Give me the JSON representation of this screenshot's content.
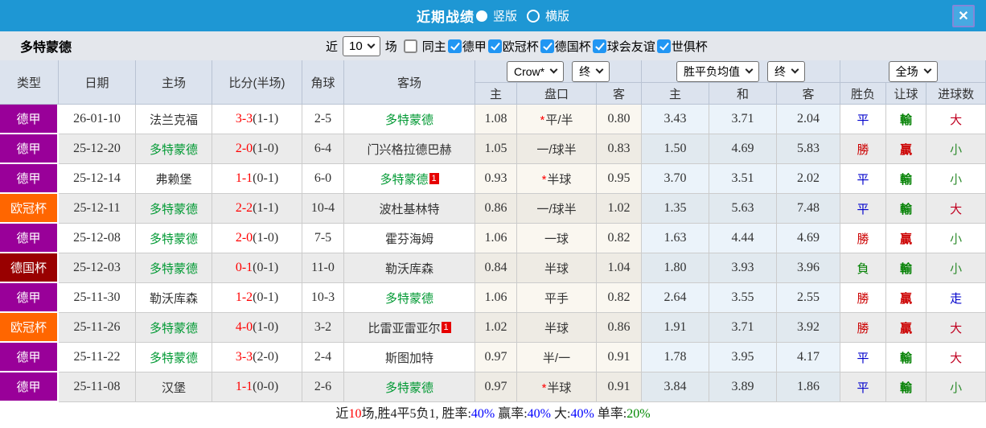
{
  "titlebar": {
    "title": "近期战绩",
    "view_options": [
      {
        "label": "竖版",
        "selected": true
      },
      {
        "label": "横版",
        "selected": false
      }
    ],
    "close_label": "✕"
  },
  "filterbar": {
    "team": "多特蒙德",
    "recent_label": "近",
    "recent_count": "10",
    "unit_label": "场",
    "same_home": {
      "label": "同主",
      "checked": false
    },
    "leagues": [
      {
        "label": "德甲",
        "checked": true
      },
      {
        "label": "欧冠杯",
        "checked": true
      },
      {
        "label": "德国杯",
        "checked": true
      },
      {
        "label": "球会友谊",
        "checked": true
      },
      {
        "label": "世俱杯",
        "checked": true
      }
    ]
  },
  "table": {
    "left_headers": [
      "类型",
      "日期",
      "主场",
      "比分(半场)",
      "角球",
      "客场"
    ],
    "odds_dropdowns": {
      "source": "Crow*",
      "stage": "终"
    },
    "mean_dropdowns": {
      "label": "胜平负均值",
      "stage": "终"
    },
    "scope_dropdown": {
      "label": "全场"
    },
    "sub_headers": [
      "主",
      "盘口",
      "客",
      "主",
      "和",
      "客",
      "胜负",
      "让球",
      "进球数"
    ],
    "rows": [
      {
        "league": "德甲",
        "league_color": "purple",
        "date": "26-01-10",
        "home": "法兰克福",
        "home_is_team": false,
        "score": "3-3",
        "half": "(1-1)",
        "corners": "2-5",
        "away": "多特蒙德",
        "away_is_team": true,
        "away_note": "",
        "odds_home": "1.08",
        "handicap": "平/半",
        "handicap_star": true,
        "odds_away": "0.80",
        "mean_home": "3.43",
        "mean_draw": "3.71",
        "mean_away": "2.04",
        "result": "平",
        "result_type": "draw",
        "handicap_result": "輸",
        "handicap_result_type": "loss",
        "goals": "大",
        "goals_type": "big"
      },
      {
        "league": "德甲",
        "league_color": "purple",
        "date": "25-12-20",
        "home": "多特蒙德",
        "home_is_team": true,
        "score": "2-0",
        "half": "(1-0)",
        "corners": "6-4",
        "away": "门兴格拉德巴赫",
        "away_is_team": false,
        "away_note": "",
        "odds_home": "1.05",
        "handicap": "一/球半",
        "handicap_star": false,
        "odds_away": "0.83",
        "mean_home": "1.50",
        "mean_draw": "4.69",
        "mean_away": "5.83",
        "result": "勝",
        "result_type": "win",
        "handicap_result": "贏",
        "handicap_result_type": "win",
        "goals": "小",
        "goals_type": "small"
      },
      {
        "league": "德甲",
        "league_color": "purple",
        "date": "25-12-14",
        "home": "弗赖堡",
        "home_is_team": false,
        "score": "1-1",
        "half": "(0-1)",
        "corners": "6-0",
        "away": "多特蒙德",
        "away_is_team": true,
        "away_note": "1",
        "odds_home": "0.93",
        "handicap": "半球",
        "handicap_star": true,
        "odds_away": "0.95",
        "mean_home": "3.70",
        "mean_draw": "3.51",
        "mean_away": "2.02",
        "result": "平",
        "result_type": "draw",
        "handicap_result": "輸",
        "handicap_result_type": "loss",
        "goals": "小",
        "goals_type": "small"
      },
      {
        "league": "欧冠杯",
        "league_color": "orange",
        "date": "25-12-11",
        "home": "多特蒙德",
        "home_is_team": true,
        "score": "2-2",
        "half": "(1-1)",
        "corners": "10-4",
        "away": "波杜基林特",
        "away_is_team": false,
        "away_note": "",
        "odds_home": "0.86",
        "handicap": "一/球半",
        "handicap_star": false,
        "odds_away": "1.02",
        "mean_home": "1.35",
        "mean_draw": "5.63",
        "mean_away": "7.48",
        "result": "平",
        "result_type": "draw",
        "handicap_result": "輸",
        "handicap_result_type": "loss",
        "goals": "大",
        "goals_type": "big"
      },
      {
        "league": "德甲",
        "league_color": "purple",
        "date": "25-12-08",
        "home": "多特蒙德",
        "home_is_team": true,
        "score": "2-0",
        "half": "(1-0)",
        "corners": "7-5",
        "away": "霍芬海姆",
        "away_is_team": false,
        "away_note": "",
        "odds_home": "1.06",
        "handicap": "一球",
        "handicap_star": false,
        "odds_away": "0.82",
        "mean_home": "1.63",
        "mean_draw": "4.44",
        "mean_away": "4.69",
        "result": "勝",
        "result_type": "win",
        "handicap_result": "贏",
        "handicap_result_type": "win",
        "goals": "小",
        "goals_type": "small"
      },
      {
        "league": "德国杯",
        "league_color": "darkred",
        "date": "25-12-03",
        "home": "多特蒙德",
        "home_is_team": true,
        "score": "0-1",
        "half": "(0-1)",
        "corners": "11-0",
        "away": "勒沃库森",
        "away_is_team": false,
        "away_note": "",
        "odds_home": "0.84",
        "handicap": "半球",
        "handicap_star": false,
        "odds_away": "1.04",
        "mean_home": "1.80",
        "mean_draw": "3.93",
        "mean_away": "3.96",
        "result": "負",
        "result_type": "loss",
        "handicap_result": "輸",
        "handicap_result_type": "loss",
        "goals": "小",
        "goals_type": "small"
      },
      {
        "league": "德甲",
        "league_color": "purple",
        "date": "25-11-30",
        "home": "勒沃库森",
        "home_is_team": false,
        "score": "1-2",
        "half": "(0-1)",
        "corners": "10-3",
        "away": "多特蒙德",
        "away_is_team": true,
        "away_note": "",
        "odds_home": "1.06",
        "handicap": "平手",
        "handicap_star": false,
        "odds_away": "0.82",
        "mean_home": "2.64",
        "mean_draw": "3.55",
        "mean_away": "2.55",
        "result": "勝",
        "result_type": "win",
        "handicap_result": "贏",
        "handicap_result_type": "win",
        "goals": "走",
        "goals_type": "walk"
      },
      {
        "league": "欧冠杯",
        "league_color": "orange",
        "date": "25-11-26",
        "home": "多特蒙德",
        "home_is_team": true,
        "score": "4-0",
        "half": "(1-0)",
        "corners": "3-2",
        "away": "比雷亚雷亚尔",
        "away_is_team": false,
        "away_note": "1",
        "odds_home": "1.02",
        "handicap": "半球",
        "handicap_star": false,
        "odds_away": "0.86",
        "mean_home": "1.91",
        "mean_draw": "3.71",
        "mean_away": "3.92",
        "result": "勝",
        "result_type": "win",
        "handicap_result": "贏",
        "handicap_result_type": "win",
        "goals": "大",
        "goals_type": "big"
      },
      {
        "league": "德甲",
        "league_color": "purple",
        "date": "25-11-22",
        "home": "多特蒙德",
        "home_is_team": true,
        "score": "3-3",
        "half": "(2-0)",
        "corners": "2-4",
        "away": "斯图加特",
        "away_is_team": false,
        "away_note": "",
        "odds_home": "0.97",
        "handicap": "半/一",
        "handicap_star": false,
        "odds_away": "0.91",
        "mean_home": "1.78",
        "mean_draw": "3.95",
        "mean_away": "4.17",
        "result": "平",
        "result_type": "draw",
        "handicap_result": "輸",
        "handicap_result_type": "loss",
        "goals": "大",
        "goals_type": "big"
      },
      {
        "league": "德甲",
        "league_color": "purple",
        "date": "25-11-08",
        "home": "汉堡",
        "home_is_team": false,
        "score": "1-1",
        "half": "(0-0)",
        "corners": "2-6",
        "away": "多特蒙德",
        "away_is_team": true,
        "away_note": "",
        "odds_home": "0.97",
        "handicap": "半球",
        "handicap_star": true,
        "odds_away": "0.91",
        "mean_home": "3.84",
        "mean_draw": "3.89",
        "mean_away": "1.86",
        "result": "平",
        "result_type": "draw",
        "handicap_result": "輸",
        "handicap_result_type": "loss",
        "goals": "小",
        "goals_type": "small"
      }
    ]
  },
  "summary": {
    "segments": [
      {
        "text": "近",
        "color": "black"
      },
      {
        "text": "10",
        "color": "red"
      },
      {
        "text": "场,胜4平5负1, 胜率:",
        "color": "black"
      },
      {
        "text": "40%",
        "color": "blue"
      },
      {
        "text": " 赢率:",
        "color": "black"
      },
      {
        "text": "40%",
        "color": "blue"
      },
      {
        "text": " 大:",
        "color": "black"
      },
      {
        "text": "40%",
        "color": "blue"
      },
      {
        "text": " 单率:",
        "color": "black"
      },
      {
        "text": "20%",
        "color": "green"
      }
    ]
  },
  "colors": {
    "titlebar_blue": "#1e97d4",
    "badge_purple": "#990099",
    "badge_orange": "#ff6600",
    "badge_darkred": "#990000",
    "team_green": "#009933",
    "score_red": "#ff0000",
    "win_red": "#cc0000",
    "draw_blue": "#0000cc",
    "loss_green": "#008000"
  }
}
